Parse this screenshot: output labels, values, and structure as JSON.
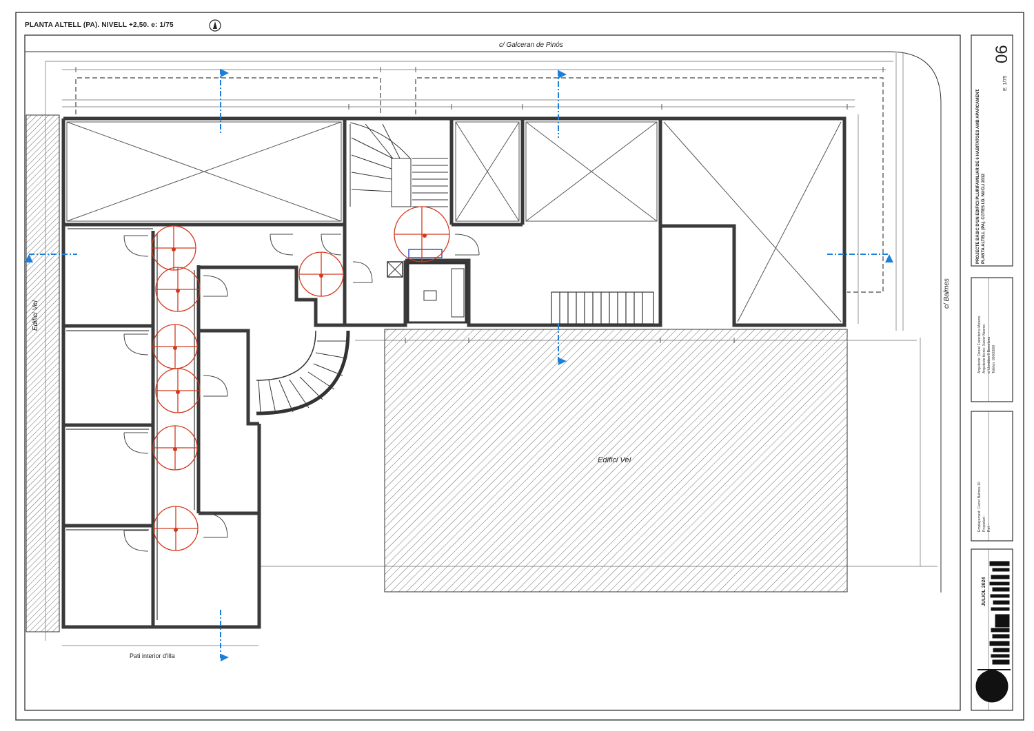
{
  "sheet": {
    "plan_title": "PLANTA ALTELL (PA). NIVELL +2,50. e: 1/75",
    "street_top": "c/ Galceran de Pinós",
    "street_right": "c/ Balmes",
    "adjacent_building_left": "Edifici Veí",
    "adjacent_building_main": "Edifici Veí",
    "courtyard_label": "Pati interior d'illa"
  },
  "title_block": {
    "sheet_number": "06",
    "scale": "E: 1/75",
    "project_lines": [
      "PROJECTE BÀSIC D'UN EDIFICI PLURIFAMILIAR DE 6 HABITATGES AMB APARCAMENT.",
      "PLANTA ALTELL (PA). COTES I.D. NUCLI 2012"
    ],
    "date": "JULIOL 2024",
    "architect_lines": [
      "Arquitecte: Daniel Francitorra Moreno",
      "Arquitecte tècnic: Xavier Nesmo",
      "c/ Llunàtics 8 Barcelona",
      "Telèfon: 00000000"
    ],
    "location_lines": [
      "Emplaçament: Carrer Balmes 10",
      "Propietari: -",
      "Ref: -"
    ]
  },
  "colors": {
    "line": "#2b2b2b",
    "wall": "#3a3a3a",
    "hatch": "#6a6a6a",
    "section_arrow": "#1e7fd8",
    "turning_circle": "#d4391c",
    "device_box": "#3553c6"
  },
  "icons": {
    "north": "north-arrow-icon",
    "section_marker": "section-arrow-icon",
    "accessibility_circle": "turning-circle-icon"
  }
}
